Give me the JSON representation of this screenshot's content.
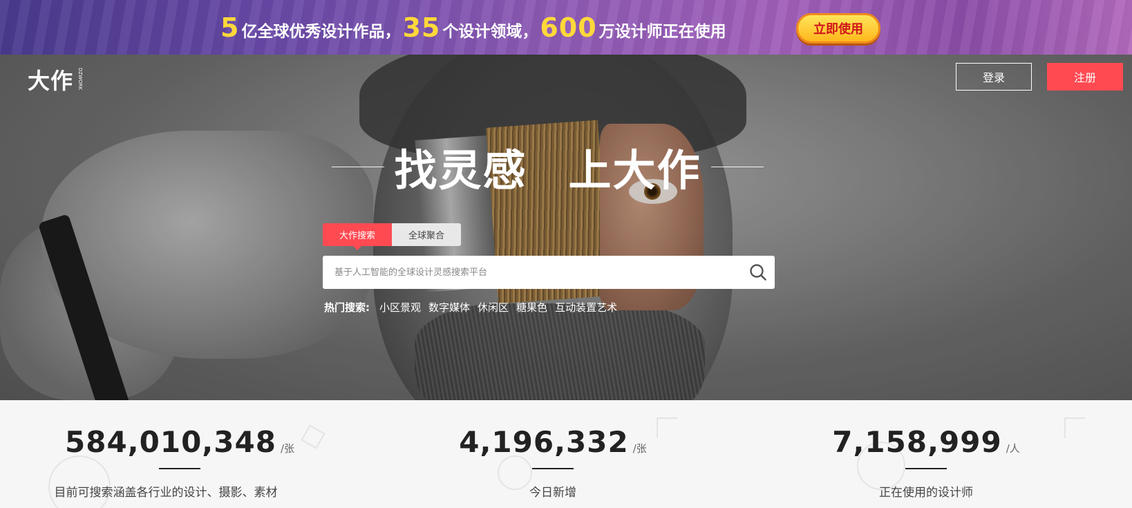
{
  "promo": {
    "segments": [
      {
        "num": "5",
        "text": "亿全球优秀设计作品，"
      },
      {
        "num": "35",
        "text": "个设计领域，"
      },
      {
        "num": "600",
        "text": "万设计师正在使用"
      }
    ],
    "cta": "立即使用"
  },
  "header": {
    "logo": "大作",
    "logo_badge": "DZWORK",
    "login": "登录",
    "register": "注册"
  },
  "hero": {
    "slogan_left": "找灵感",
    "slogan_right": "上大作"
  },
  "search": {
    "tabs": [
      "大作搜索",
      "全球聚合"
    ],
    "active_tab": 0,
    "placeholder": "基于人工智能的全球设计灵感搜索平台",
    "value": ""
  },
  "hot": {
    "label": "热门搜索:",
    "items": [
      "小区景观",
      "数字媒体",
      "休闲区",
      "糖果色",
      "互动装置艺术"
    ]
  },
  "stats": [
    {
      "value": "584,010,348",
      "unit": "/张",
      "label": "目前可搜索涵盖各行业的设计、摄影、素材"
    },
    {
      "value": "4,196,332",
      "unit": "/张",
      "label": "今日新增"
    },
    {
      "value": "7,158,999",
      "unit": "/人",
      "label": "正在使用的设计师"
    }
  ],
  "colors": {
    "accent": "#ff4a52",
    "promo_number": "#ffd83a",
    "cta_text": "#d0161a"
  }
}
